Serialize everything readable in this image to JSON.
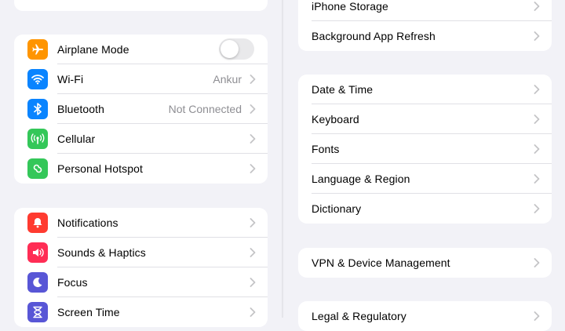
{
  "left": {
    "group_connectivity": [
      {
        "label": "Airplane Mode",
        "icon": "airplane-icon",
        "color": "#ff9500",
        "toggle": "off"
      },
      {
        "label": "Wi-Fi",
        "value": "Ankur",
        "icon": "wifi-icon",
        "color": "#0a84ff"
      },
      {
        "label": "Bluetooth",
        "value": "Not Connected",
        "icon": "bluetooth-icon",
        "color": "#0a84ff"
      },
      {
        "label": "Cellular",
        "icon": "cellular-icon",
        "color": "#34c759"
      },
      {
        "label": "Personal Hotspot",
        "icon": "hotspot-icon",
        "color": "#34c759"
      }
    ],
    "group_notifications": [
      {
        "label": "Notifications",
        "icon": "bell-icon",
        "color": "#ff3b30"
      },
      {
        "label": "Sounds & Haptics",
        "icon": "speaker-icon",
        "color": "#ff2d55"
      },
      {
        "label": "Focus",
        "icon": "moon-icon",
        "color": "#5856d6"
      },
      {
        "label": "Screen Time",
        "icon": "hourglass-icon",
        "color": "#5856d6"
      }
    ]
  },
  "right": {
    "group_storage": [
      {
        "label": "iPhone Storage"
      },
      {
        "label": "Background App Refresh"
      }
    ],
    "group_general": [
      {
        "label": "Date & Time"
      },
      {
        "label": "Keyboard"
      },
      {
        "label": "Fonts"
      },
      {
        "label": "Language & Region"
      },
      {
        "label": "Dictionary"
      }
    ],
    "group_vpn": [
      {
        "label": "VPN & Device Management"
      }
    ],
    "group_legal": [
      {
        "label": "Legal & Regulatory"
      }
    ]
  }
}
